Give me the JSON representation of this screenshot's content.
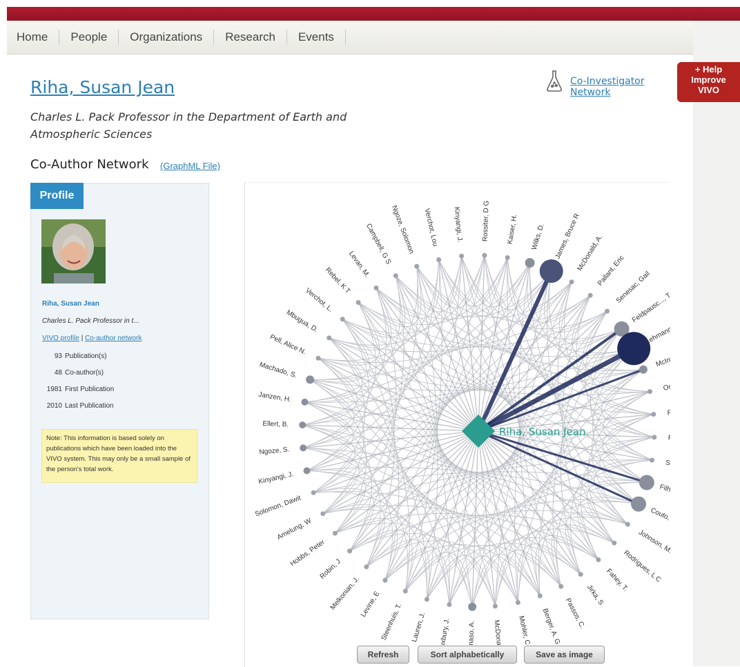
{
  "nav": [
    "Home",
    "People",
    "Organizations",
    "Research",
    "Events"
  ],
  "help_label": "+ Help\nImprove\nVIVO",
  "person": {
    "name": "Riha, Susan Jean",
    "title": "Charles L. Pack Professor in the Department of Earth and Atmospheric Sciences"
  },
  "coinvestigator_link": "Co-Investigator\nNetwork",
  "network_title": "Co-Author Network",
  "graphml_link": "(GraphML File)",
  "profile": {
    "tab": "Profile",
    "name": "Riha, Susan Jean",
    "title_short": "Charles L. Pack Professor in t...",
    "link_vivo": "VIVO profile",
    "link_sep": " | ",
    "link_coauthor": "Co-author network",
    "stats": [
      {
        "value": "93",
        "label": "Publication(s)"
      },
      {
        "value": "48",
        "label": "Co-author(s)"
      },
      {
        "value": "1981",
        "label": "First Publication"
      },
      {
        "value": "2010",
        "label": "Last Publication"
      }
    ],
    "note": "Note: This information is based solely on publications which have been loaded into the VIVO system. This may only be a small sample of the person's total work."
  },
  "graph": {
    "center_label": "Riha, Susan Jean",
    "center_color": "#2a9d8f",
    "node_color": "#9ea3ad",
    "strong_color": "#1f2a5c",
    "coauthors": [
      "Rossiter, D G",
      "Kaiser, H.",
      "Wilks, D.",
      "James, Bruce R",
      "McDonald, A.",
      "Pallant, Eric",
      "Senesac, Gail",
      "Feldpausc..., T.",
      "Lehmann, C.",
      "McIntyre, B D",
      "Ong, C K",
      "Flower, D",
      "Fernande",
      "Selva, E",
      "Filho, J P.N",
      "Couto, E G",
      "Johnson, M.",
      "Rodrigues, L C",
      "Fahey, T.",
      "Jirka, S",
      "Passos, C.",
      "Berger, A. G.",
      "Mohler, C.",
      "McDonald, A",
      "Tommaso, A.",
      "Duxbury, J.",
      "Lauren, J.",
      "Steenhuis, T.",
      "Levine, E",
      "Melkonian, J.",
      "Robin, J",
      "Hobbs, Peter",
      "Amelung, W",
      "Solomon, Dawit",
      "Kinyangi, J.",
      "Ngoze, S.",
      "Ellert, B.",
      "Janzen, H.",
      "Machado, S.",
      "Pell, Alice N.",
      "Mbugua, D.",
      "Verchot, L.",
      "Rebel, K T",
      "Levan, M.",
      "Campbell, G S",
      "Ngoze, Solomon",
      "Verchot, Lou",
      "Kinyangi, J."
    ]
  },
  "buttons": [
    "Refresh",
    "Sort alphabetically",
    "Save as image"
  ]
}
